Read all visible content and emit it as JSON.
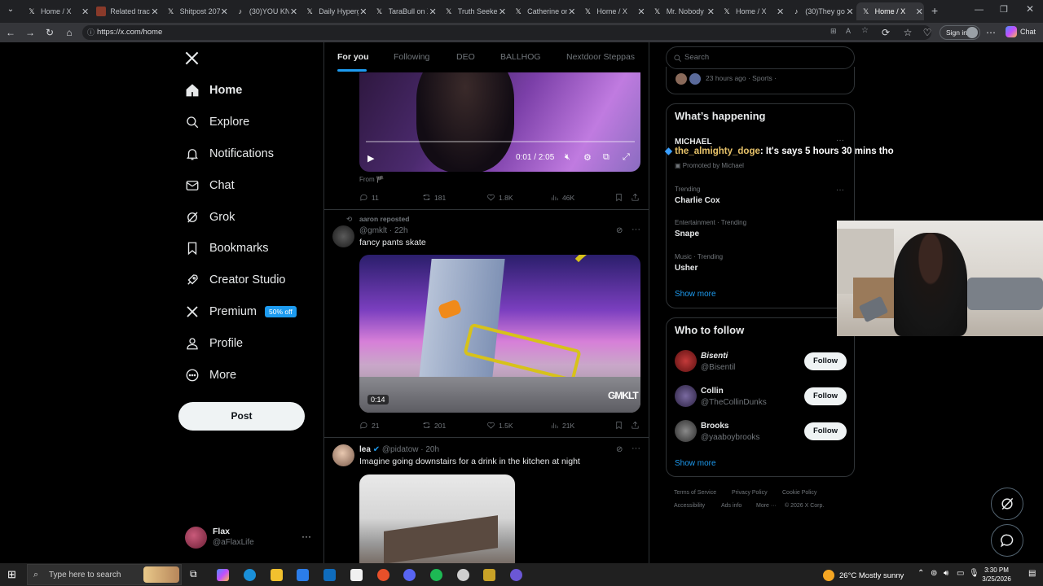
{
  "browser": {
    "tabs": [
      {
        "title": "Home / X",
        "icon": "x-logo-icon"
      },
      {
        "title": "Related track",
        "icon": "video-thumbnail-icon"
      },
      {
        "title": "Shitpost 207",
        "icon": "x-logo-icon"
      },
      {
        "title": "(30)YOU KNO",
        "icon": "tiktok-icon"
      },
      {
        "title": "Daily Hyperg",
        "icon": "x-logo-icon"
      },
      {
        "title": "TaraBull on X",
        "icon": "x-logo-icon"
      },
      {
        "title": "Truth Seeker",
        "icon": "x-logo-icon"
      },
      {
        "title": "Catherine on",
        "icon": "x-logo-icon"
      },
      {
        "title": "Home / X",
        "icon": "x-logo-icon"
      },
      {
        "title": "Mr. Nobody",
        "icon": "x-logo-icon"
      },
      {
        "title": "Home / X",
        "icon": "x-logo-icon"
      },
      {
        "title": "(30)They got",
        "icon": "tiktok-icon"
      },
      {
        "title": "Home / X",
        "icon": "x-logo-icon",
        "active": true
      }
    ],
    "url": "https://x.com/home",
    "signin_label": "Sign in",
    "chat_label": "Chat"
  },
  "sidebar": {
    "items": [
      {
        "label": "Home",
        "icon": "home-icon"
      },
      {
        "label": "Explore",
        "icon": "search-icon"
      },
      {
        "label": "Notifications",
        "icon": "bell-icon"
      },
      {
        "label": "Chat",
        "icon": "mail-icon"
      },
      {
        "label": "Grok",
        "icon": "grok-icon"
      },
      {
        "label": "Bookmarks",
        "icon": "bookmark-icon"
      },
      {
        "label": "Creator Studio",
        "icon": "rocket-icon"
      },
      {
        "label": "Premium",
        "icon": "x-logo-icon",
        "badge": "50% off"
      },
      {
        "label": "Profile",
        "icon": "person-icon"
      },
      {
        "label": "More",
        "icon": "more-circle-icon"
      }
    ],
    "post_label": "Post",
    "account": {
      "name": "Flax",
      "handle": "@aFlaxLife"
    }
  },
  "feed": {
    "tabs": [
      "For you",
      "Following",
      "DEO",
      "BALLHOG",
      "Nextdoor Steppas"
    ],
    "post1": {
      "time": "0:01 / 2:05",
      "from_label": "From",
      "replies": "11",
      "reposts": "181",
      "likes": "1.8K",
      "views": "46K"
    },
    "post2": {
      "reposted_by": "aaron reposted",
      "handle": "@gmklt",
      "time": "22h",
      "text": "fancy pants skate",
      "video_time": "0:14",
      "watermark": "GMKLT",
      "replies": "21",
      "reposts": "201",
      "likes": "1.5K",
      "views": "21K"
    },
    "post3": {
      "name": "lea",
      "handle": "@pidatow",
      "time": "20h",
      "text": "Imagine going downstairs for a drink in the kitchen at night"
    }
  },
  "right": {
    "search_placeholder": "Search",
    "top_meta": "23 hours ago · Sports ·",
    "happening_title": "What’s happening",
    "promoted": {
      "title": "MICHAEL",
      "label": "Promoted by Michael"
    },
    "trends": [
      {
        "meta": "Trending",
        "name": "Charlie Cox"
      },
      {
        "meta": "Entertainment · Trending",
        "name": "Snape"
      },
      {
        "meta": "Music · Trending",
        "name": "Usher"
      }
    ],
    "show_more": "Show more",
    "follow_title": "Who to follow",
    "follow": [
      {
        "name": "Bisenti",
        "handle": "@Bisentil"
      },
      {
        "name": "Collin",
        "handle": "@TheCollinDunks"
      },
      {
        "name": "Brooks",
        "handle": "@yaaboybrooks"
      }
    ],
    "follow_label": "Follow",
    "footer": [
      "Terms of Service",
      "Privacy Policy",
      "Cookie Policy",
      "Accessibility",
      "Ads info",
      "More ···",
      "© 2026 X Corp."
    ]
  },
  "overlay": {
    "chat_user": "the_almighty_doge",
    "chat_message": "It's says 5 hours 30 mins tho"
  },
  "taskbar": {
    "search_placeholder": "Type here to search",
    "weather": "26°C  Mostly sunny",
    "time": "3:30 PM",
    "date": "3/25/2026"
  }
}
